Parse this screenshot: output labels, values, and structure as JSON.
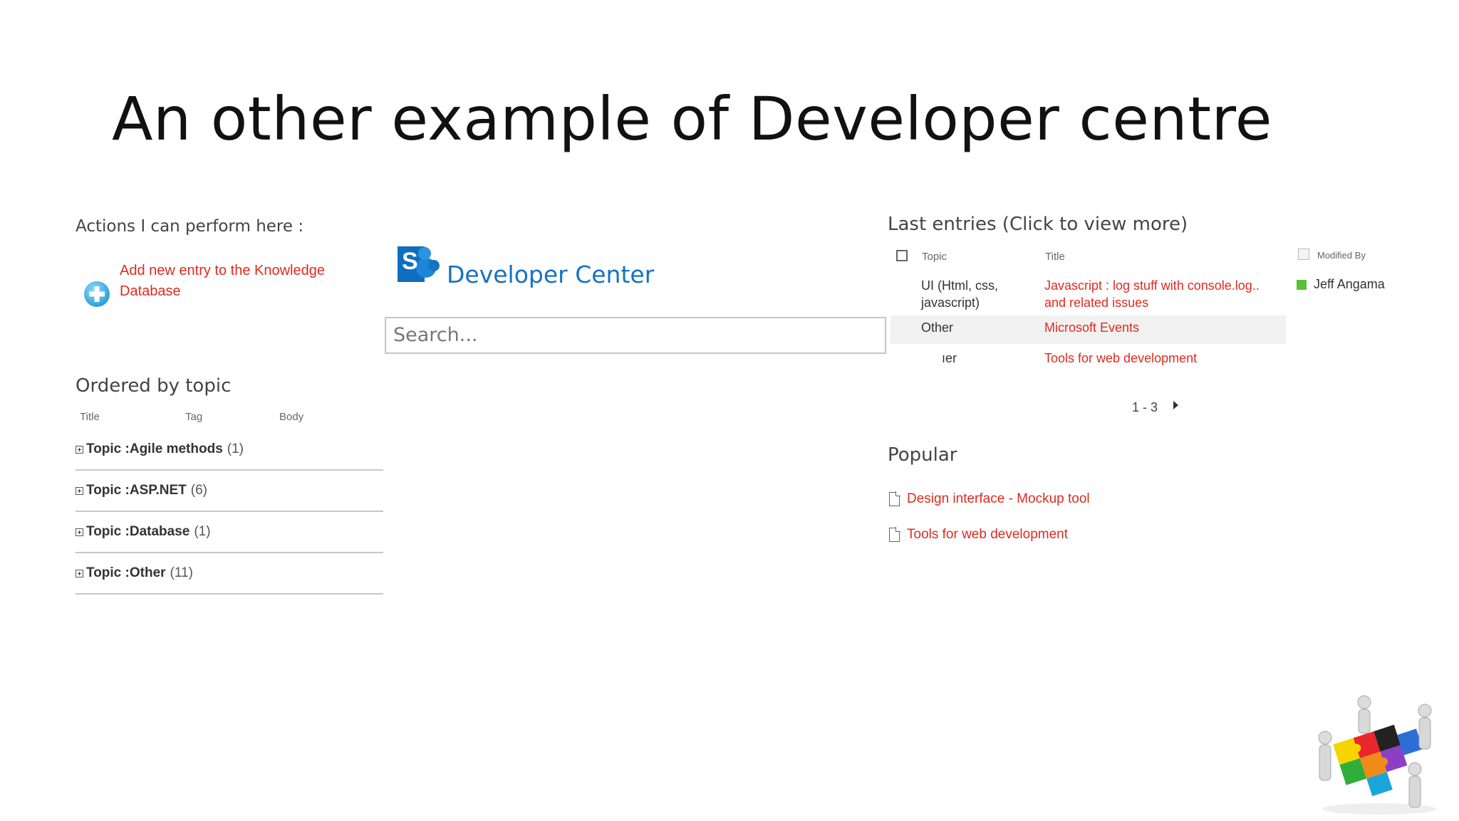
{
  "slide": {
    "title": "An other example of Developer centre"
  },
  "actions": {
    "heading": "Actions I can perform here :",
    "add_link_line1": "Add new entry to the Knowledge",
    "add_link_line2": "Database"
  },
  "brand": {
    "name": "Developer Center",
    "logo_letter": "S"
  },
  "search": {
    "placeholder": "Search..."
  },
  "ordered": {
    "heading": "Ordered by topic",
    "columns": [
      "Title",
      "Tag",
      "Body"
    ],
    "groups": [
      {
        "prefix": "Topic : ",
        "name": "Agile methods",
        "count": "(1)"
      },
      {
        "prefix": "Topic : ",
        "name": "ASP.NET",
        "count": "(6)"
      },
      {
        "prefix": "Topic : ",
        "name": "Database",
        "count": "(1)"
      },
      {
        "prefix": "Topic : ",
        "name": "Other",
        "count": "(11)"
      }
    ]
  },
  "last_entries": {
    "heading": "Last entries (Click to view more)",
    "col_topic": "Topic",
    "col_title": "Title",
    "col_modified": "Modified By",
    "rows": [
      {
        "topic_line1": "UI (Html, css,",
        "topic_line2": "javascript)",
        "title_line1": "Javascript : log stuff with console.log..",
        "title_line2": "and related issues",
        "modified_by": "Jeff Angama"
      },
      {
        "topic": "Other",
        "title": "Microsoft Events"
      },
      {
        "topic": "ıer",
        "title": "Tools for web development"
      }
    ],
    "paging": "1 - 3"
  },
  "popular": {
    "heading": "Popular",
    "items": [
      "Design interface - Mockup tool",
      "Tools for web development"
    ]
  },
  "colors": {
    "accent_red": "#e02a1f",
    "brand_blue": "#1572c4",
    "presence_green": "#5cbf3a"
  }
}
